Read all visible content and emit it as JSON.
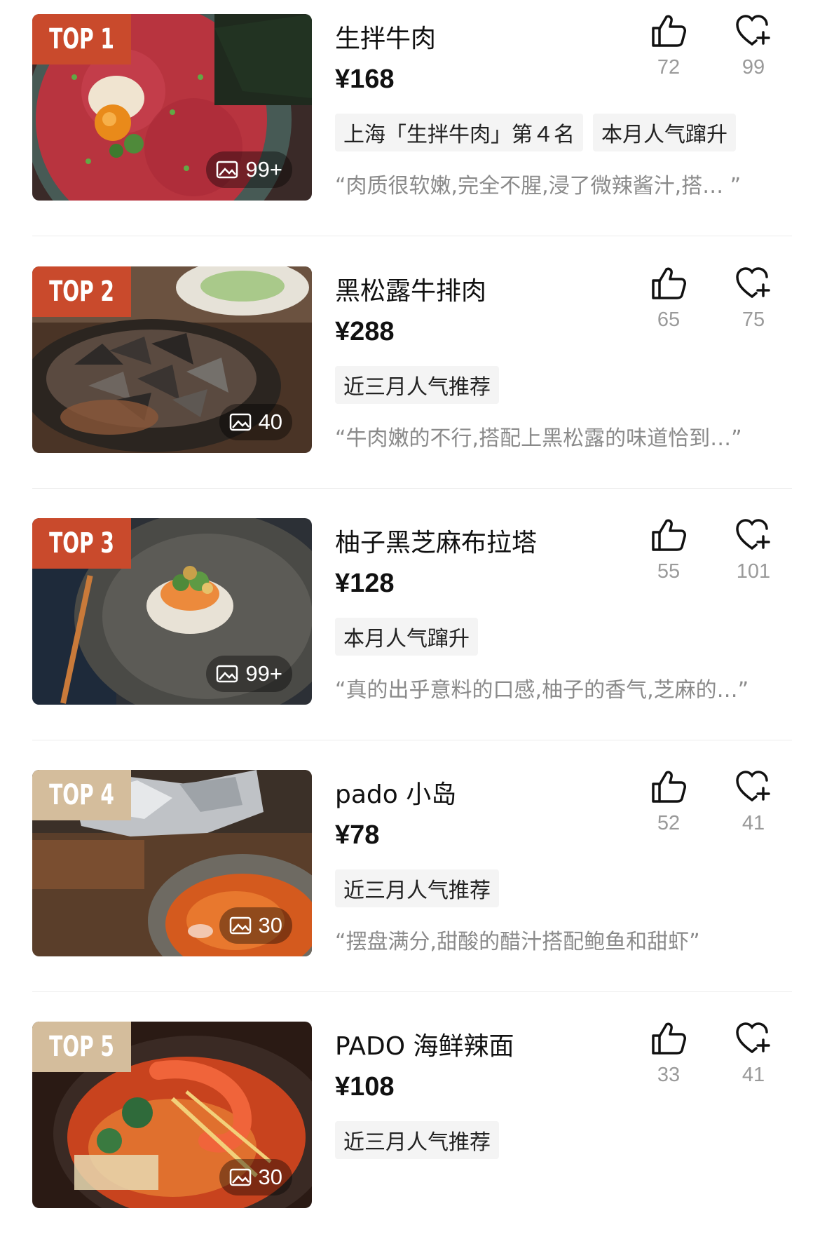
{
  "colors": {
    "rank_top3": "#c94a2c",
    "rank_other": "#d4bd9c",
    "tag_bg": "#f4f4f4",
    "muted_text": "#8a8a8a"
  },
  "items": [
    {
      "rank": "TOP 1",
      "photo_count": "99+",
      "name": "生拌牛肉",
      "price": "¥168",
      "tags": [
        "上海「生拌牛肉」第４名",
        "本月人气蹿升"
      ],
      "quote": "“肉质很软嫩,完全不腥,浸了微辣酱汁,搭…  ”",
      "likes": "72",
      "favorites": "99",
      "icon_like": "thumbs-up-icon",
      "icon_fav": "heart-plus-icon"
    },
    {
      "rank": "TOP 2",
      "photo_count": "40",
      "name": "黑松露牛排肉",
      "price": "¥288",
      "tags": [
        "近三月人气推荐"
      ],
      "quote": "“牛肉嫩的不行,搭配上黑松露的味道恰到…”",
      "likes": "65",
      "favorites": "75",
      "icon_like": "thumbs-up-icon",
      "icon_fav": "heart-plus-icon"
    },
    {
      "rank": "TOP 3",
      "photo_count": "99+",
      "name": "柚子黑芝麻布拉塔",
      "price": "¥128",
      "tags": [
        "本月人气蹿升"
      ],
      "quote": "“真的出乎意料的口感,柚子的香气,芝麻的…”",
      "likes": "55",
      "favorites": "101",
      "icon_like": "thumbs-up-icon",
      "icon_fav": "heart-plus-icon"
    },
    {
      "rank": "TOP 4",
      "photo_count": "30",
      "name": "pado 小岛",
      "price": "¥78",
      "tags": [
        "近三月人气推荐"
      ],
      "quote": "“摆盘满分,甜酸的醋汁搭配鲍鱼和甜虾”",
      "likes": "52",
      "favorites": "41",
      "icon_like": "thumbs-up-icon",
      "icon_fav": "heart-plus-icon"
    },
    {
      "rank": "TOP 5",
      "photo_count": "30",
      "name": "PADO 海鲜辣面",
      "price": "¥108",
      "tags": [
        "近三月人气推荐"
      ],
      "quote": "",
      "likes": "33",
      "favorites": "41",
      "icon_like": "thumbs-up-icon",
      "icon_fav": "heart-plus-icon"
    }
  ]
}
